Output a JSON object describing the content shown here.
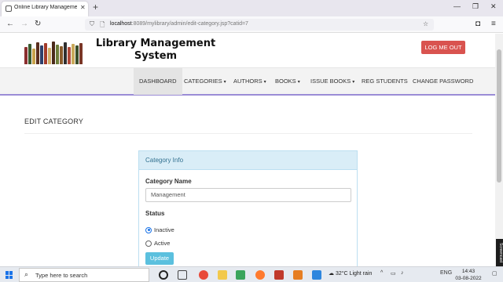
{
  "browser": {
    "tab_title": "Online Library Management Sys",
    "url_host": "localhost",
    "url_path": ":8089/mylibrary/admin/edit-category.jsp?catid=7"
  },
  "site": {
    "title_line1": "Library Management",
    "title_line2": "System",
    "logout_label": "LOG ME OUT"
  },
  "menu": {
    "items": [
      {
        "label": "DASHBOARD",
        "has_caret": false
      },
      {
        "label": "CATEGORIES",
        "has_caret": true
      },
      {
        "label": "AUTHORS",
        "has_caret": true
      },
      {
        "label": "BOOKS",
        "has_caret": true
      },
      {
        "label": "ISSUE BOOKS",
        "has_caret": true
      },
      {
        "label": "REG STUDENTS",
        "has_caret": false
      },
      {
        "label": "CHANGE PASSWORD",
        "has_caret": false
      }
    ]
  },
  "page": {
    "heading": "EDIT CATEGORY"
  },
  "form": {
    "panel_heading": "Category Info",
    "name_label": "Category Name",
    "name_value": "Management",
    "status_label": "Status",
    "status_options": [
      {
        "label": "Inactive",
        "checked": true
      },
      {
        "label": "Active",
        "checked": false
      }
    ],
    "submit_label": "Update"
  },
  "taskbar": {
    "search_placeholder": "Type here to search",
    "weather_temp": "32°C",
    "weather_text": "Light rain",
    "language": "ENG",
    "time": "14:43",
    "date": "03-08-2022"
  },
  "colors": {
    "logout": "#d9534f",
    "update_button": "#5bc0de",
    "panel_heading_bg": "#d9edf7",
    "menu_underline": "#9b8cd6"
  }
}
